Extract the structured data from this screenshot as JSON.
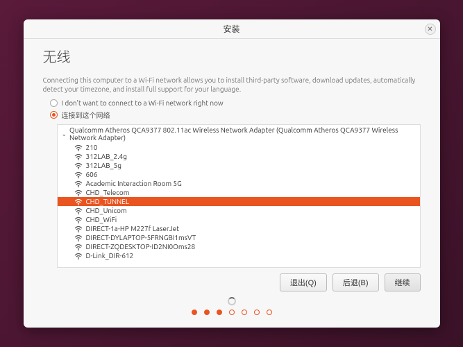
{
  "titlebar": {
    "title": "安装"
  },
  "heading": "无线",
  "description": "Connecting this computer to a Wi-Fi network allows you to install third-party software, download updates, automatically detect your timezone, and install full support for your language.",
  "options": {
    "no_connect": "I don't want to connect to a Wi-Fi network right now",
    "connect": "连接到这个网络"
  },
  "adapter": "Qualcomm Atheros QCA9377 802.11ac Wireless Network Adapter (Qualcomm Atheros QCA9377 Wireless Network Adapter)",
  "networks": [
    {
      "name": "210",
      "selected": false
    },
    {
      "name": "312LAB_2.4g",
      "selected": false
    },
    {
      "name": "312LAB_5g",
      "selected": false
    },
    {
      "name": "606",
      "selected": false
    },
    {
      "name": "Academic Interaction Room 5G",
      "selected": false
    },
    {
      "name": "CHD_Telecom",
      "selected": false
    },
    {
      "name": "CHD_TUNNEL",
      "selected": true
    },
    {
      "name": "CHD_Unicom",
      "selected": false
    },
    {
      "name": "CHD_WiFi",
      "selected": false
    },
    {
      "name": "DIRECT-1a-HP M227f LaserJet",
      "selected": false
    },
    {
      "name": "DIRECT-DYLAPTOP-5FRNGBI1msVT",
      "selected": false
    },
    {
      "name": "DIRECT-ZQDESKTOP-ID2NI0Oms28",
      "selected": false
    },
    {
      "name": "D-Link_DIR-612",
      "selected": false
    }
  ],
  "buttons": {
    "quit": "退出(Q)",
    "back": "后退(B)",
    "continue": "继续"
  },
  "progress": {
    "total": 7,
    "current": 3
  }
}
